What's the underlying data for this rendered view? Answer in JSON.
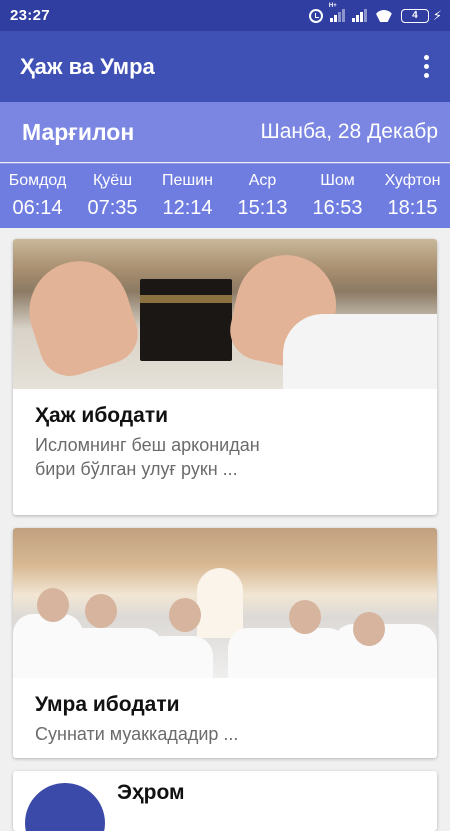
{
  "status_bar": {
    "time": "23:27",
    "network_label": "H+",
    "battery": "4",
    "icons": [
      "alarm-icon",
      "signal-icon",
      "signal-icon",
      "wifi-icon",
      "battery-icon",
      "charging-icon"
    ]
  },
  "app_bar": {
    "title": "Ҳаж ва Умра",
    "menu_icon": "more-vert-icon"
  },
  "location": {
    "city": "Марғилон",
    "date": "Шанба, 28 Декабр"
  },
  "prayer_times": [
    {
      "name": "Бомдод",
      "time": "06:14"
    },
    {
      "name": "Қуёш",
      "time": "07:35"
    },
    {
      "name": "Пешин",
      "time": "12:14"
    },
    {
      "name": "Аср",
      "time": "15:13"
    },
    {
      "name": "Шом",
      "time": "16:53"
    },
    {
      "name": "Хуфтон",
      "time": "18:15"
    }
  ],
  "cards": [
    {
      "title": "Ҳаж ибодати",
      "text": "Исломнинг беш арконидан бири бўлган улуғ рукн ..."
    },
    {
      "title": "Умра ибодати",
      "text": "Суннати муаккададир ..."
    },
    {
      "title": "Эҳром",
      "text": ""
    }
  ],
  "colors": {
    "status_bar": "#2f3ea0",
    "app_bar": "#3f51b5",
    "location_bar": "#7b86e2",
    "prayer_bar": "#6f7de0",
    "background": "#f0f0f0"
  }
}
